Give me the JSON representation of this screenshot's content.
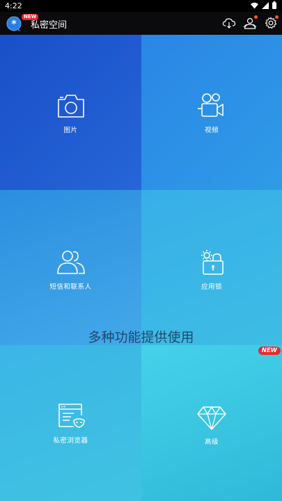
{
  "status_bar": {
    "time": "4:22"
  },
  "app_bar": {
    "title": "私密空间",
    "new_badge": "NEW"
  },
  "tiles": [
    {
      "label": "图片"
    },
    {
      "label": "视频"
    },
    {
      "label": "短信和联系人"
    },
    {
      "label": "应用锁"
    },
    {
      "label": "私密浏览器"
    },
    {
      "label": "高级"
    }
  ],
  "tagline": "多种功能提供使用",
  "tile_new_badge": "NEW",
  "colors": {
    "accent_red": "#e8282d",
    "notification_dot": "#ff5a1f"
  }
}
